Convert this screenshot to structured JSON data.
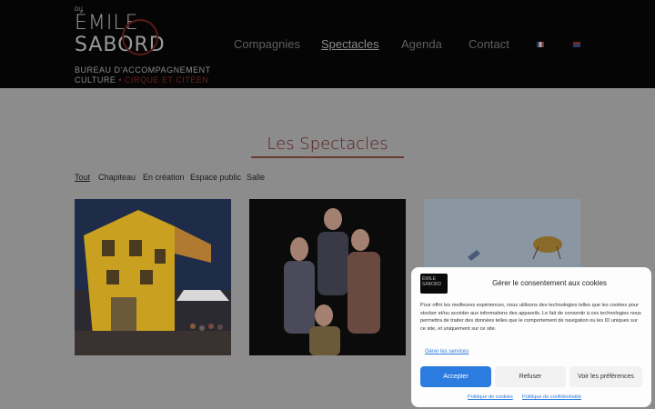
{
  "header": {
    "logo": {
      "small": "DU",
      "line1": "ÉMILE",
      "line2": "SABORD",
      "tag1": "BUREAU D'ACCOMPAGNEMENT",
      "tag2_a": "CULTURE",
      "tag2_dot": "•",
      "tag2_b": "CIRQUE ET CITÉEN"
    },
    "nav": [
      "Compagnies",
      "Spectacles",
      "Agenda",
      "Contact"
    ],
    "active_nav": "Spectacles",
    "languages": [
      "fr-flag-icon",
      "en-flag-icon"
    ]
  },
  "main": {
    "title": "Les Spectacles",
    "filters": [
      "Tout",
      "Chapiteau",
      "En création",
      "Espace public",
      "Salle"
    ],
    "active_filter": "Tout",
    "cards": [
      "show-photo-yellow-house",
      "show-photo-actors",
      "show-photo-sky"
    ]
  },
  "consent": {
    "logo_text": "ÉMILE SABORD",
    "title": "Gérer le consentement aux cookies",
    "text": "Pour offrir les meilleures expériences, nous utilisons des technologies telles que les cookies pour stocker et/ou accéder aux informations des appareils. Le fait de consentir à ces technologies nous permettra de traiter des données telles que le comportement de navigation ou les ID uniques sur ce site, et uniquement sur ce site.",
    "manage_link": "Gérer les services",
    "accept": "Accepter",
    "refuse": "Refuser",
    "prefs": "Voir les préférences",
    "cookie_policy": "Politique de cookies",
    "privacy_policy": "Politique de confidentialité"
  },
  "colors": {
    "accent": "#2c7ce0",
    "title_color": "#5a1a1e",
    "overlay": "#8c8c8c"
  }
}
